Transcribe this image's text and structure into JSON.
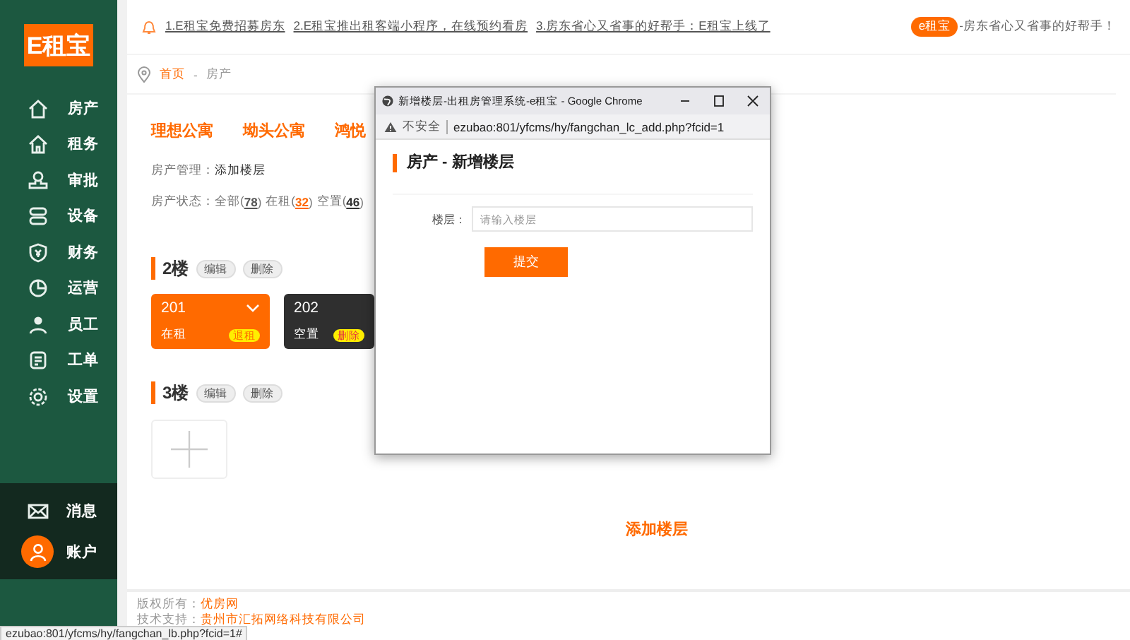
{
  "sidebar": {
    "logo": "E租宝",
    "items": [
      {
        "label": "房产"
      },
      {
        "label": "租务"
      },
      {
        "label": "审批"
      },
      {
        "label": "设备"
      },
      {
        "label": "财务"
      },
      {
        "label": "运营"
      },
      {
        "label": "员工"
      },
      {
        "label": "工单"
      },
      {
        "label": "设置"
      }
    ],
    "bottom_items": [
      {
        "label": "消息",
        "kind": "mail"
      },
      {
        "label": "账户",
        "kind": "avatar"
      }
    ]
  },
  "notice_bar": {
    "links": [
      "1.E租宝免费招募房东",
      "2.E租宝推出租客端小程序，在线预约看房",
      "3.房东省心又省事的好帮手：E租宝上线了"
    ],
    "badge": "e租宝",
    "slogan": "-房东省心又省事的好帮手！"
  },
  "breadcrumb": {
    "items": [
      "首页",
      "房产"
    ],
    "separator": "-"
  },
  "apartment_tabs": [
    "理想公寓",
    "坳头公寓",
    "鸿悦"
  ],
  "management": {
    "label": "房产管理：",
    "action": "添加楼层"
  },
  "status_filter": {
    "label": "房产状态：",
    "items": [
      {
        "label": "全部(",
        "count": "78",
        "close": ")",
        "color": "#555555"
      },
      {
        "label": "在租(",
        "count": "32",
        "close": ")",
        "color": "#ff6600"
      },
      {
        "label": "空置(",
        "count": "46",
        "close": ")",
        "color": "#333333"
      }
    ]
  },
  "floors": [
    {
      "name": "2楼",
      "actions": [
        "编辑",
        "删除"
      ],
      "rooms": [
        {
          "number": "201",
          "status": "在租",
          "kind": "rented",
          "expandable": true,
          "badges": [
            "退租"
          ]
        },
        {
          "number": "202",
          "status": "空置",
          "kind": "vacant",
          "expandable": false,
          "badges": [
            "删除"
          ]
        }
      ]
    },
    {
      "name": "3楼",
      "actions": [
        "编辑",
        "删除"
      ]
    }
  ],
  "add_floor_link": "添加楼层",
  "footer": {
    "copyright_label": "版权所有：",
    "copyright_name": "优房网",
    "support_label": "技术支持：",
    "support_name": "贵州市汇拓网络科技有限公司"
  },
  "status_url": "ezubao:801/yfcms/hy/fangchan_lb.php?fcid=1#",
  "popup": {
    "title": "新增楼层-出租房管理系统-e租宝 - Google Chrome",
    "security": "不安全",
    "url": "ezubao:801/yfcms/hy/fangchan_lc_add.php?fcid=1",
    "heading": "房产 - 新增楼层",
    "field_label": "楼层：",
    "placeholder": "请输入楼层",
    "submit": "提交"
  }
}
